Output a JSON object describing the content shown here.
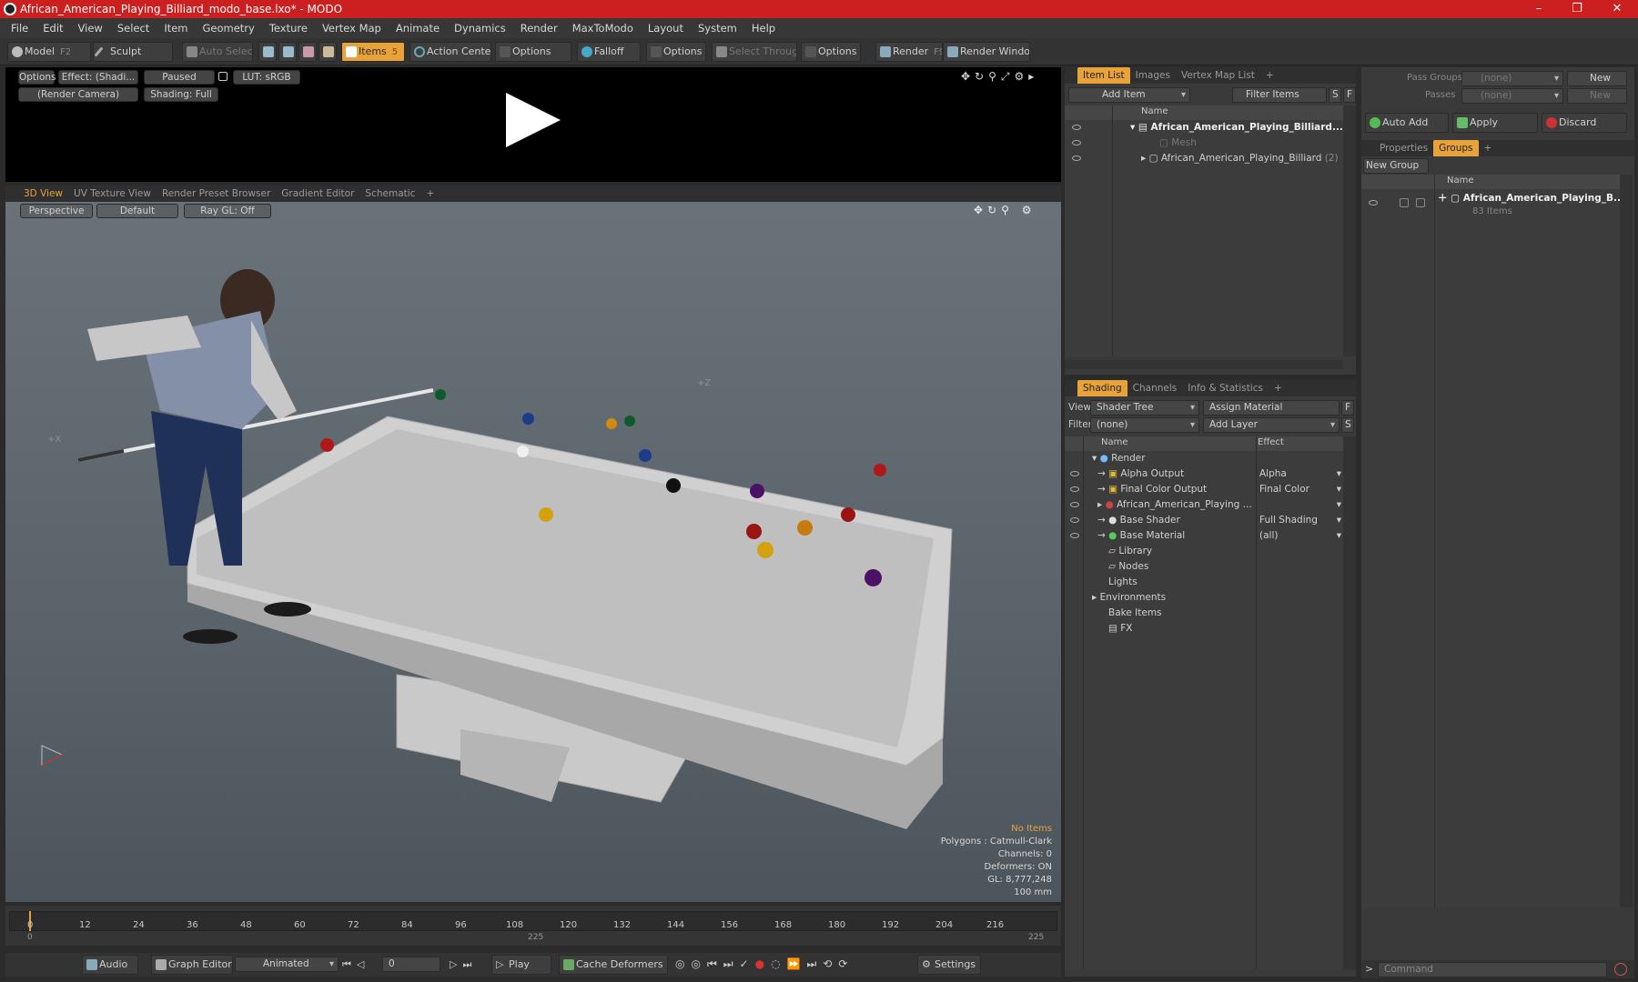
{
  "window": {
    "title": "African_American_Playing_Billiard_modo_base.lxo* - MODO",
    "minimize": "–",
    "maximize": "❐",
    "close": "✕"
  },
  "menu": [
    "File",
    "Edit",
    "View",
    "Select",
    "Item",
    "Geometry",
    "Texture",
    "Vertex Map",
    "Animate",
    "Dynamics",
    "Render",
    "MaxToModo",
    "Layout",
    "System",
    "Help"
  ],
  "toolbar": {
    "model": "Model",
    "model_key": "F2",
    "sculpt": "Sculpt",
    "auto_select": "Auto Select",
    "items": "Items",
    "items_key": "5",
    "action_center": "Action Center",
    "options1": "Options",
    "falloff": "Falloff",
    "options2": "Options",
    "select_through": "Select Through",
    "options3": "Options",
    "render": "Render",
    "render_key": "F9",
    "render_window": "Render Window"
  },
  "preview": {
    "options": "Options",
    "effect": "Effect: (Shadi...",
    "paused": "Paused",
    "lut": "LUT: sRGB",
    "camera": "(Render Camera)",
    "shading": "Shading: Full"
  },
  "viewport_tabs": [
    "3D View",
    "UV Texture View",
    "Render Preset Browser",
    "Gradient Editor",
    "Schematic",
    "+"
  ],
  "viewport": {
    "perspective": "Perspective",
    "default": "Default",
    "raygl": "Ray GL: Off",
    "axis_x": "+X",
    "axis_z": "+Z",
    "info": {
      "no_items": "No Items",
      "polygons": "Polygons : Catmull-Clark",
      "channels": "Channels: 0",
      "deformers": "Deformers: ON",
      "gl": "GL: 8,777,248",
      "scale": "100 mm"
    }
  },
  "timeline": {
    "ticks": [
      "0",
      "12",
      "24",
      "36",
      "48",
      "60",
      "72",
      "84",
      "96",
      "108",
      "120",
      "132",
      "144",
      "156",
      "168",
      "180",
      "192",
      "204",
      "216"
    ],
    "start": "0",
    "mid": "225",
    "end": "225"
  },
  "transport": {
    "audio": "Audio",
    "graph_editor": "Graph Editor",
    "animated": "Animated",
    "frame": "0",
    "play": "Play",
    "cache_deformers": "Cache Deformers",
    "settings": "Settings"
  },
  "item_list": {
    "tabs": [
      "Item List",
      "Images",
      "Vertex Map List",
      "+"
    ],
    "add_item": "Add Item",
    "filter_items": "Filter Items",
    "s": "S",
    "f": "F",
    "col_name": "Name",
    "rows": [
      {
        "label": "African_American_Playing_Billiard..."
      },
      {
        "label": "Mesh"
      },
      {
        "label": "African_American_Playing_Billiard",
        "count": "(2)"
      }
    ]
  },
  "shading": {
    "tabs": [
      "Shading",
      "Channels",
      "Info & Statistics",
      "+"
    ],
    "view_label": "View",
    "view_value": "Shader Tree",
    "assign_material": "Assign Material",
    "f": "F",
    "filter_label": "Filter",
    "filter_value": "(none)",
    "add_layer": "Add Layer",
    "s": "S",
    "col_name": "Name",
    "col_effect": "Effect",
    "rows": [
      {
        "name": "Render",
        "effect": ""
      },
      {
        "name": "Alpha Output",
        "effect": "Alpha"
      },
      {
        "name": "Final Color Output",
        "effect": "Final Color"
      },
      {
        "name": "African_American_Playing ...",
        "effect": ""
      },
      {
        "name": "Base Shader",
        "effect": "Full Shading"
      },
      {
        "name": "Base Material",
        "effect": "(all)"
      },
      {
        "name": "Library",
        "effect": ""
      },
      {
        "name": "Nodes",
        "effect": ""
      },
      {
        "name": "Lights",
        "effect": ""
      },
      {
        "name": "Environments",
        "effect": ""
      },
      {
        "name": "Bake Items",
        "effect": ""
      },
      {
        "name": "FX",
        "effect": ""
      }
    ]
  },
  "groups": {
    "pass_groups": "Pass Groups",
    "pass_groups_value": "(none)",
    "new1": "New",
    "passes": "Passes",
    "passes_value": "(none)",
    "new2": "New",
    "auto_add": "Auto Add",
    "apply": "Apply",
    "discard": "Discard",
    "tabs": [
      "Properties",
      "Groups",
      "+"
    ],
    "new_group": "New Group",
    "col_name": "Name",
    "group_name": "African_American_Playing_B...",
    "group_count": "83 Items"
  },
  "command": {
    "placeholder": "Command",
    "arrow": ">"
  }
}
